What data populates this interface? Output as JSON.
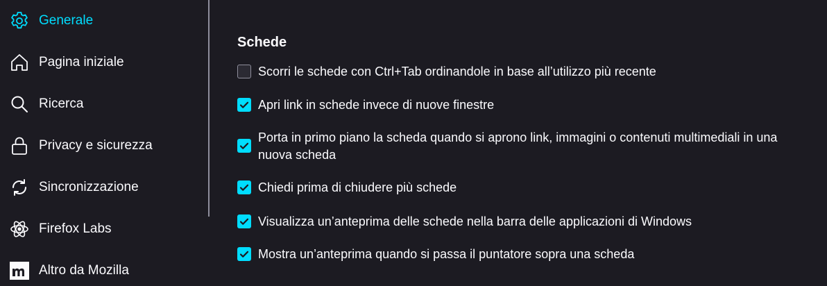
{
  "sidebar": {
    "items": [
      {
        "label": "Generale",
        "icon": "gear-icon",
        "active": true
      },
      {
        "label": "Pagina iniziale",
        "icon": "home-icon",
        "active": false
      },
      {
        "label": "Ricerca",
        "icon": "search-icon",
        "active": false
      },
      {
        "label": "Privacy e sicurezza",
        "icon": "lock-icon",
        "active": false
      },
      {
        "label": "Sincronizzazione",
        "icon": "sync-icon",
        "active": false
      },
      {
        "label": "Firefox Labs",
        "icon": "atom-icon",
        "active": false
      },
      {
        "label": "Altro da Mozilla",
        "icon": "mozilla-icon",
        "active": false
      }
    ]
  },
  "main": {
    "section_title": "Schede",
    "options": [
      {
        "label": "Scorri le schede con Ctrl+Tab ordinandole in base all’utilizzo più recente",
        "checked": false
      },
      {
        "label": "Apri link in schede invece di nuove finestre",
        "checked": true
      },
      {
        "label": "Porta in primo piano la scheda quando si aprono link, immagini o contenuti multimediali in una nuova scheda",
        "checked": true
      },
      {
        "label": "Chiedi prima di chiudere più schede",
        "checked": true
      },
      {
        "label": "Visualizza un’anteprima delle schede nella barra delle applicazioni di Windows",
        "checked": true
      },
      {
        "label": "Mostra un’anteprima quando si passa il puntatore sopra una scheda",
        "checked": true
      }
    ]
  },
  "colors": {
    "accent": "#00ddff",
    "background": "#1c1b22",
    "text": "#fbfbfe"
  }
}
